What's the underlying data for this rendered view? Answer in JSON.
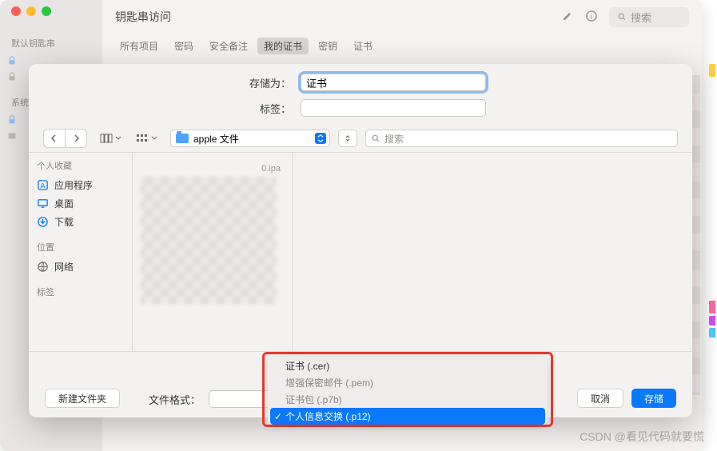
{
  "parent_window": {
    "title": "钥匙串访问",
    "sidebar": {
      "section1_title": "默认钥匙串",
      "section2_title": "系统钥",
      "items": []
    },
    "toolbar_search_placeholder": "搜索",
    "tabs": [
      "所有项目",
      "密码",
      "安全备注",
      "我的证书",
      "密钥",
      "证书"
    ],
    "active_tab_index": 3
  },
  "sheet": {
    "save_as_label": "存储为：",
    "save_as_value": "证书",
    "tags_label": "标签：",
    "tags_value": "",
    "location": {
      "name": "apple 文件"
    },
    "search_placeholder": "搜索",
    "favorites": {
      "title": "个人收藏",
      "items": [
        {
          "icon": "app",
          "label": "应用程序",
          "color": "#0a78ff"
        },
        {
          "icon": "desktop",
          "label": "桌面",
          "color": "#0a78ff"
        },
        {
          "icon": "download",
          "label": "下载",
          "color": "#0a78ff"
        }
      ],
      "locations_title": "位置",
      "locations": [
        {
          "icon": "globe",
          "label": "网络",
          "color": "#7a7674"
        }
      ],
      "tags_title": "标签"
    },
    "column1_file": "0.ipa",
    "file_format_label": "文件格式：",
    "format_options": [
      {
        "label": "证书 (.cer)",
        "enabled": true,
        "selected": false
      },
      {
        "label": "增强保密邮件 (.pem)",
        "enabled": false,
        "selected": false
      },
      {
        "label": "证书包 (.p7b)",
        "enabled": false,
        "selected": false
      },
      {
        "label": "个人信息交换 (.p12)",
        "enabled": true,
        "selected": true
      }
    ],
    "new_folder_button": "新建文件夹",
    "cancel_button": "取消",
    "save_button": "存储"
  },
  "watermark": "CSDN @看见代码就要慌"
}
